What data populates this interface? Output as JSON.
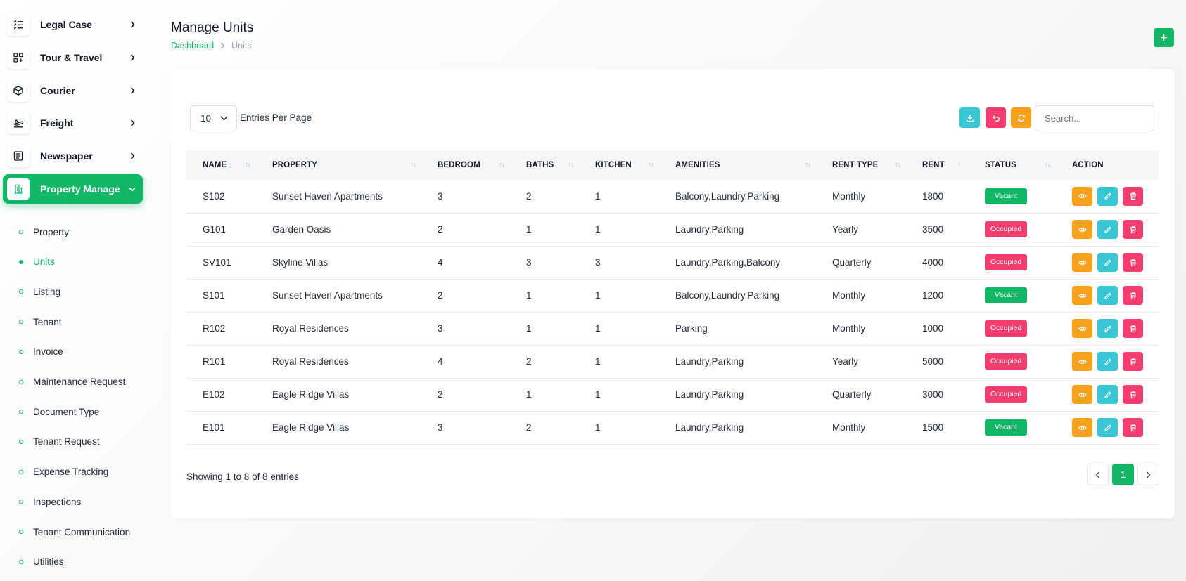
{
  "sidebar": {
    "menu": [
      {
        "label": "Legal Case",
        "icon": "list-check-icon"
      },
      {
        "label": "Tour & Travel",
        "icon": "apps-icon"
      },
      {
        "label": "Courier",
        "icon": "package-icon"
      },
      {
        "label": "Freight",
        "icon": "plane-icon"
      },
      {
        "label": "Newspaper",
        "icon": "newspaper-icon"
      },
      {
        "label": "Property Manage",
        "icon": "building-icon",
        "active": true
      }
    ],
    "submenu": [
      {
        "label": "Property"
      },
      {
        "label": "Units",
        "active": true
      },
      {
        "label": "Listing"
      },
      {
        "label": "Tenant"
      },
      {
        "label": "Invoice"
      },
      {
        "label": "Maintenance Request"
      },
      {
        "label": "Document Type"
      },
      {
        "label": "Tenant Request"
      },
      {
        "label": "Expense Tracking"
      },
      {
        "label": "Inspections"
      },
      {
        "label": "Tenant Communication"
      },
      {
        "label": "Utilities"
      }
    ]
  },
  "header": {
    "title": "Manage Units",
    "breadcrumb": {
      "home": "Dashboard",
      "current": "Units"
    },
    "add_button": "+"
  },
  "toolbar": {
    "entries_value": "10",
    "entries_label": "Entries Per Page",
    "search_placeholder": "Search...",
    "buttons": [
      {
        "name": "download-button",
        "icon": "download-icon",
        "color": "#38c5d4"
      },
      {
        "name": "reset-button",
        "icon": "undo-icon",
        "color": "#f33d6f"
      },
      {
        "name": "refresh-button",
        "icon": "refresh-icon",
        "color": "#f8a11c"
      }
    ]
  },
  "table": {
    "columns": [
      "NAME",
      "PROPERTY",
      "BEDROOM",
      "BATHS",
      "KITCHEN",
      "AMENITIES",
      "RENT TYPE",
      "RENT",
      "STATUS",
      "ACTION"
    ],
    "rows": [
      {
        "name": "S102",
        "property": "Sunset Haven Apartments",
        "bedroom": "3",
        "baths": "2",
        "kitchen": "1",
        "amenities": "Balcony,Laundry,Parking",
        "rent_type": "Monthly",
        "rent": "1800",
        "status": "Vacant"
      },
      {
        "name": "G101",
        "property": "Garden Oasis",
        "bedroom": "2",
        "baths": "1",
        "kitchen": "1",
        "amenities": "Laundry,Parking",
        "rent_type": "Yearly",
        "rent": "3500",
        "status": "Occupied"
      },
      {
        "name": "SV101",
        "property": "Skyline Villas",
        "bedroom": "4",
        "baths": "3",
        "kitchen": "3",
        "amenities": "Laundry,Parking,Balcony",
        "rent_type": "Quarterly",
        "rent": "4000",
        "status": "Occupied"
      },
      {
        "name": "S101",
        "property": "Sunset Haven Apartments",
        "bedroom": "2",
        "baths": "1",
        "kitchen": "1",
        "amenities": "Balcony,Laundry,Parking",
        "rent_type": "Monthly",
        "rent": "1200",
        "status": "Vacant"
      },
      {
        "name": "R102",
        "property": "Royal Residences",
        "bedroom": "3",
        "baths": "1",
        "kitchen": "1",
        "amenities": "Parking",
        "rent_type": "Monthly",
        "rent": "1000",
        "status": "Occupied"
      },
      {
        "name": "R101",
        "property": "Royal Residences",
        "bedroom": "4",
        "baths": "2",
        "kitchen": "1",
        "amenities": "Laundry,Parking",
        "rent_type": "Yearly",
        "rent": "5000",
        "status": "Occupied"
      },
      {
        "name": "E102",
        "property": "Eagle Ridge Villas",
        "bedroom": "2",
        "baths": "1",
        "kitchen": "1",
        "amenities": "Laundry,Parking",
        "rent_type": "Quarterly",
        "rent": "3000",
        "status": "Occupied"
      },
      {
        "name": "E101",
        "property": "Eagle Ridge Villas",
        "bedroom": "3",
        "baths": "2",
        "kitchen": "1",
        "amenities": "Laundry,Parking",
        "rent_type": "Monthly",
        "rent": "1500",
        "status": "Vacant"
      }
    ]
  },
  "footer": {
    "showing": "Showing 1 to 8 of 8 entries",
    "current_page": "1"
  },
  "colors": {
    "accent": "#10b767",
    "danger": "#f33d6f",
    "warning": "#f8a11c",
    "info": "#38c5d4"
  }
}
